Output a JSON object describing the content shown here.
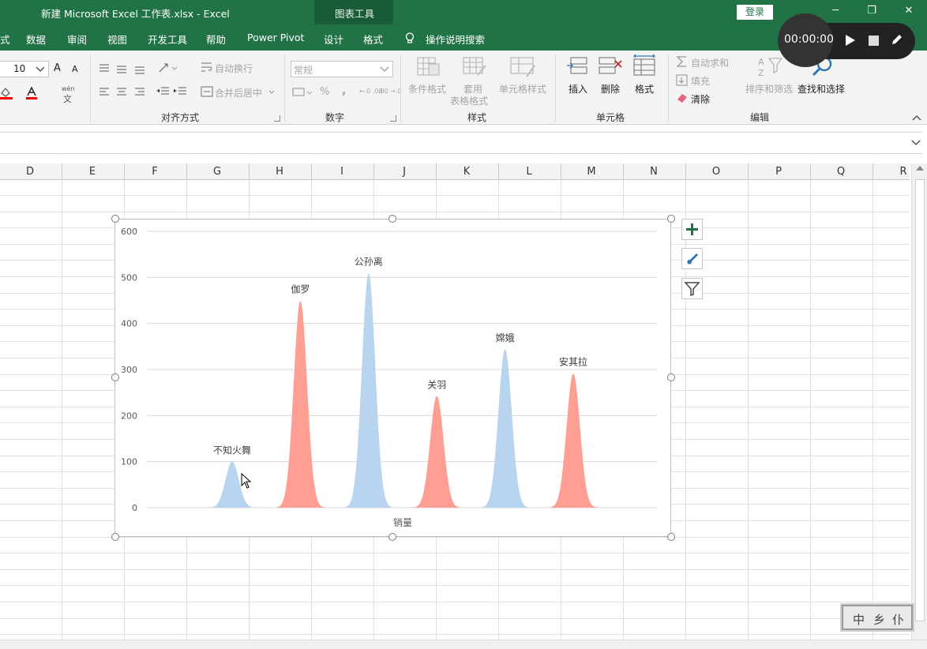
{
  "window": {
    "title": "新建 Microsoft Excel 工作表.xlsx  -  Excel",
    "context_group": "图表工具",
    "login_label": "登录",
    "min_label": "─",
    "restore_label": "❐",
    "close_label": "✕"
  },
  "tabs": [
    {
      "label": "式"
    },
    {
      "label": "数据"
    },
    {
      "label": "审阅"
    },
    {
      "label": "视图"
    },
    {
      "label": "开发工具"
    },
    {
      "label": "帮助"
    },
    {
      "label": "Power Pivot"
    },
    {
      "label": "设计"
    },
    {
      "label": "格式"
    },
    {
      "label": "操作说明搜索"
    }
  ],
  "recorder": {
    "time": "00:00:00"
  },
  "ribbon": {
    "font_size": "10",
    "font_grow": "A",
    "font_shrink": "A",
    "phonetic_top": "wén",
    "phonetic_bottom": "文",
    "wrap_text": "自动换行",
    "merge_center": "合并后居中",
    "number_format": "常规",
    "percent": "%",
    "comma": ",",
    "dec_inc": "←.0 .00",
    "dec_dec": ".00 →.0",
    "conditional_format": "条件格式",
    "table_format_1": "套用",
    "table_format_2": "表格格式",
    "cell_styles": "单元格样式",
    "insert": "插入",
    "delete": "删除",
    "format": "格式",
    "autosum": "自动求和",
    "fill": "填充",
    "clear": "清除",
    "sort_filter": "排序和筛选",
    "find_select": "查找和选择",
    "groups": {
      "alignment": "对齐方式",
      "number": "数字",
      "styles": "样式",
      "cells": "单元格",
      "editing": "编辑"
    }
  },
  "columns": [
    "D",
    "E",
    "F",
    "G",
    "H",
    "I",
    "J",
    "K",
    "L",
    "M",
    "N",
    "O",
    "P",
    "Q",
    "R"
  ],
  "colors": {
    "excel_green": "#217346",
    "series_blue": "#b9d4ee",
    "series_red": "#ff9f94"
  },
  "chart_data": {
    "type": "area",
    "xlabel": "销量",
    "ylim": [
      0,
      600
    ],
    "y_ticks": [
      "0",
      "100",
      "200",
      "300",
      "400",
      "500",
      "600"
    ],
    "grid": true,
    "legend": "none",
    "peaks": [
      {
        "label": "不知火舞",
        "value": 100,
        "color": "#b9d4ee"
      },
      {
        "label": "伽罗",
        "value": 450,
        "color": "#ff9f94"
      },
      {
        "label": "公孙离",
        "value": 510,
        "color": "#b9d4ee"
      },
      {
        "label": "关羽",
        "value": 243,
        "color": "#ff9f94"
      },
      {
        "label": "嫦娥",
        "value": 345,
        "color": "#b9d4ee"
      },
      {
        "label": "安其拉",
        "value": 292,
        "color": "#ff9f94"
      }
    ]
  },
  "watermark": [
    "中",
    "乡",
    "仆"
  ]
}
